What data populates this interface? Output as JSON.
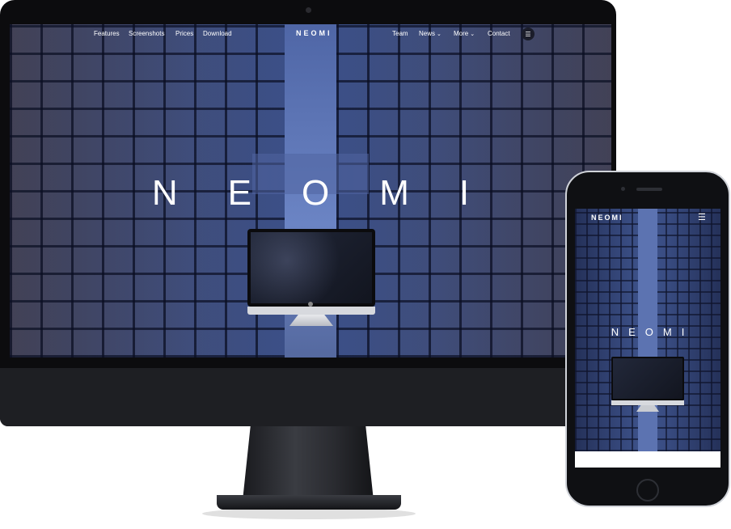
{
  "desktop": {
    "nav_left": [
      "Features",
      "Screenshots",
      "Prices",
      "Download"
    ],
    "logo": "NEOMI",
    "nav_right": [
      {
        "label": "Team",
        "dropdown": false
      },
      {
        "label": "News",
        "dropdown": true
      },
      {
        "label": "More",
        "dropdown": true
      },
      {
        "label": "Contact",
        "dropdown": false
      }
    ],
    "hero_title": "NEOMI",
    "menu_icon": "hamburger-icon",
    "chevron_icon": "chevron-down-icon"
  },
  "mobile": {
    "logo": "NEOMI",
    "hero_title": "NEOMI",
    "menu_icon": "hamburger-icon"
  },
  "colors": {
    "hero_blue": "#3b4f86",
    "device_black": "#0c0c0e",
    "text_white": "#ffffff"
  }
}
